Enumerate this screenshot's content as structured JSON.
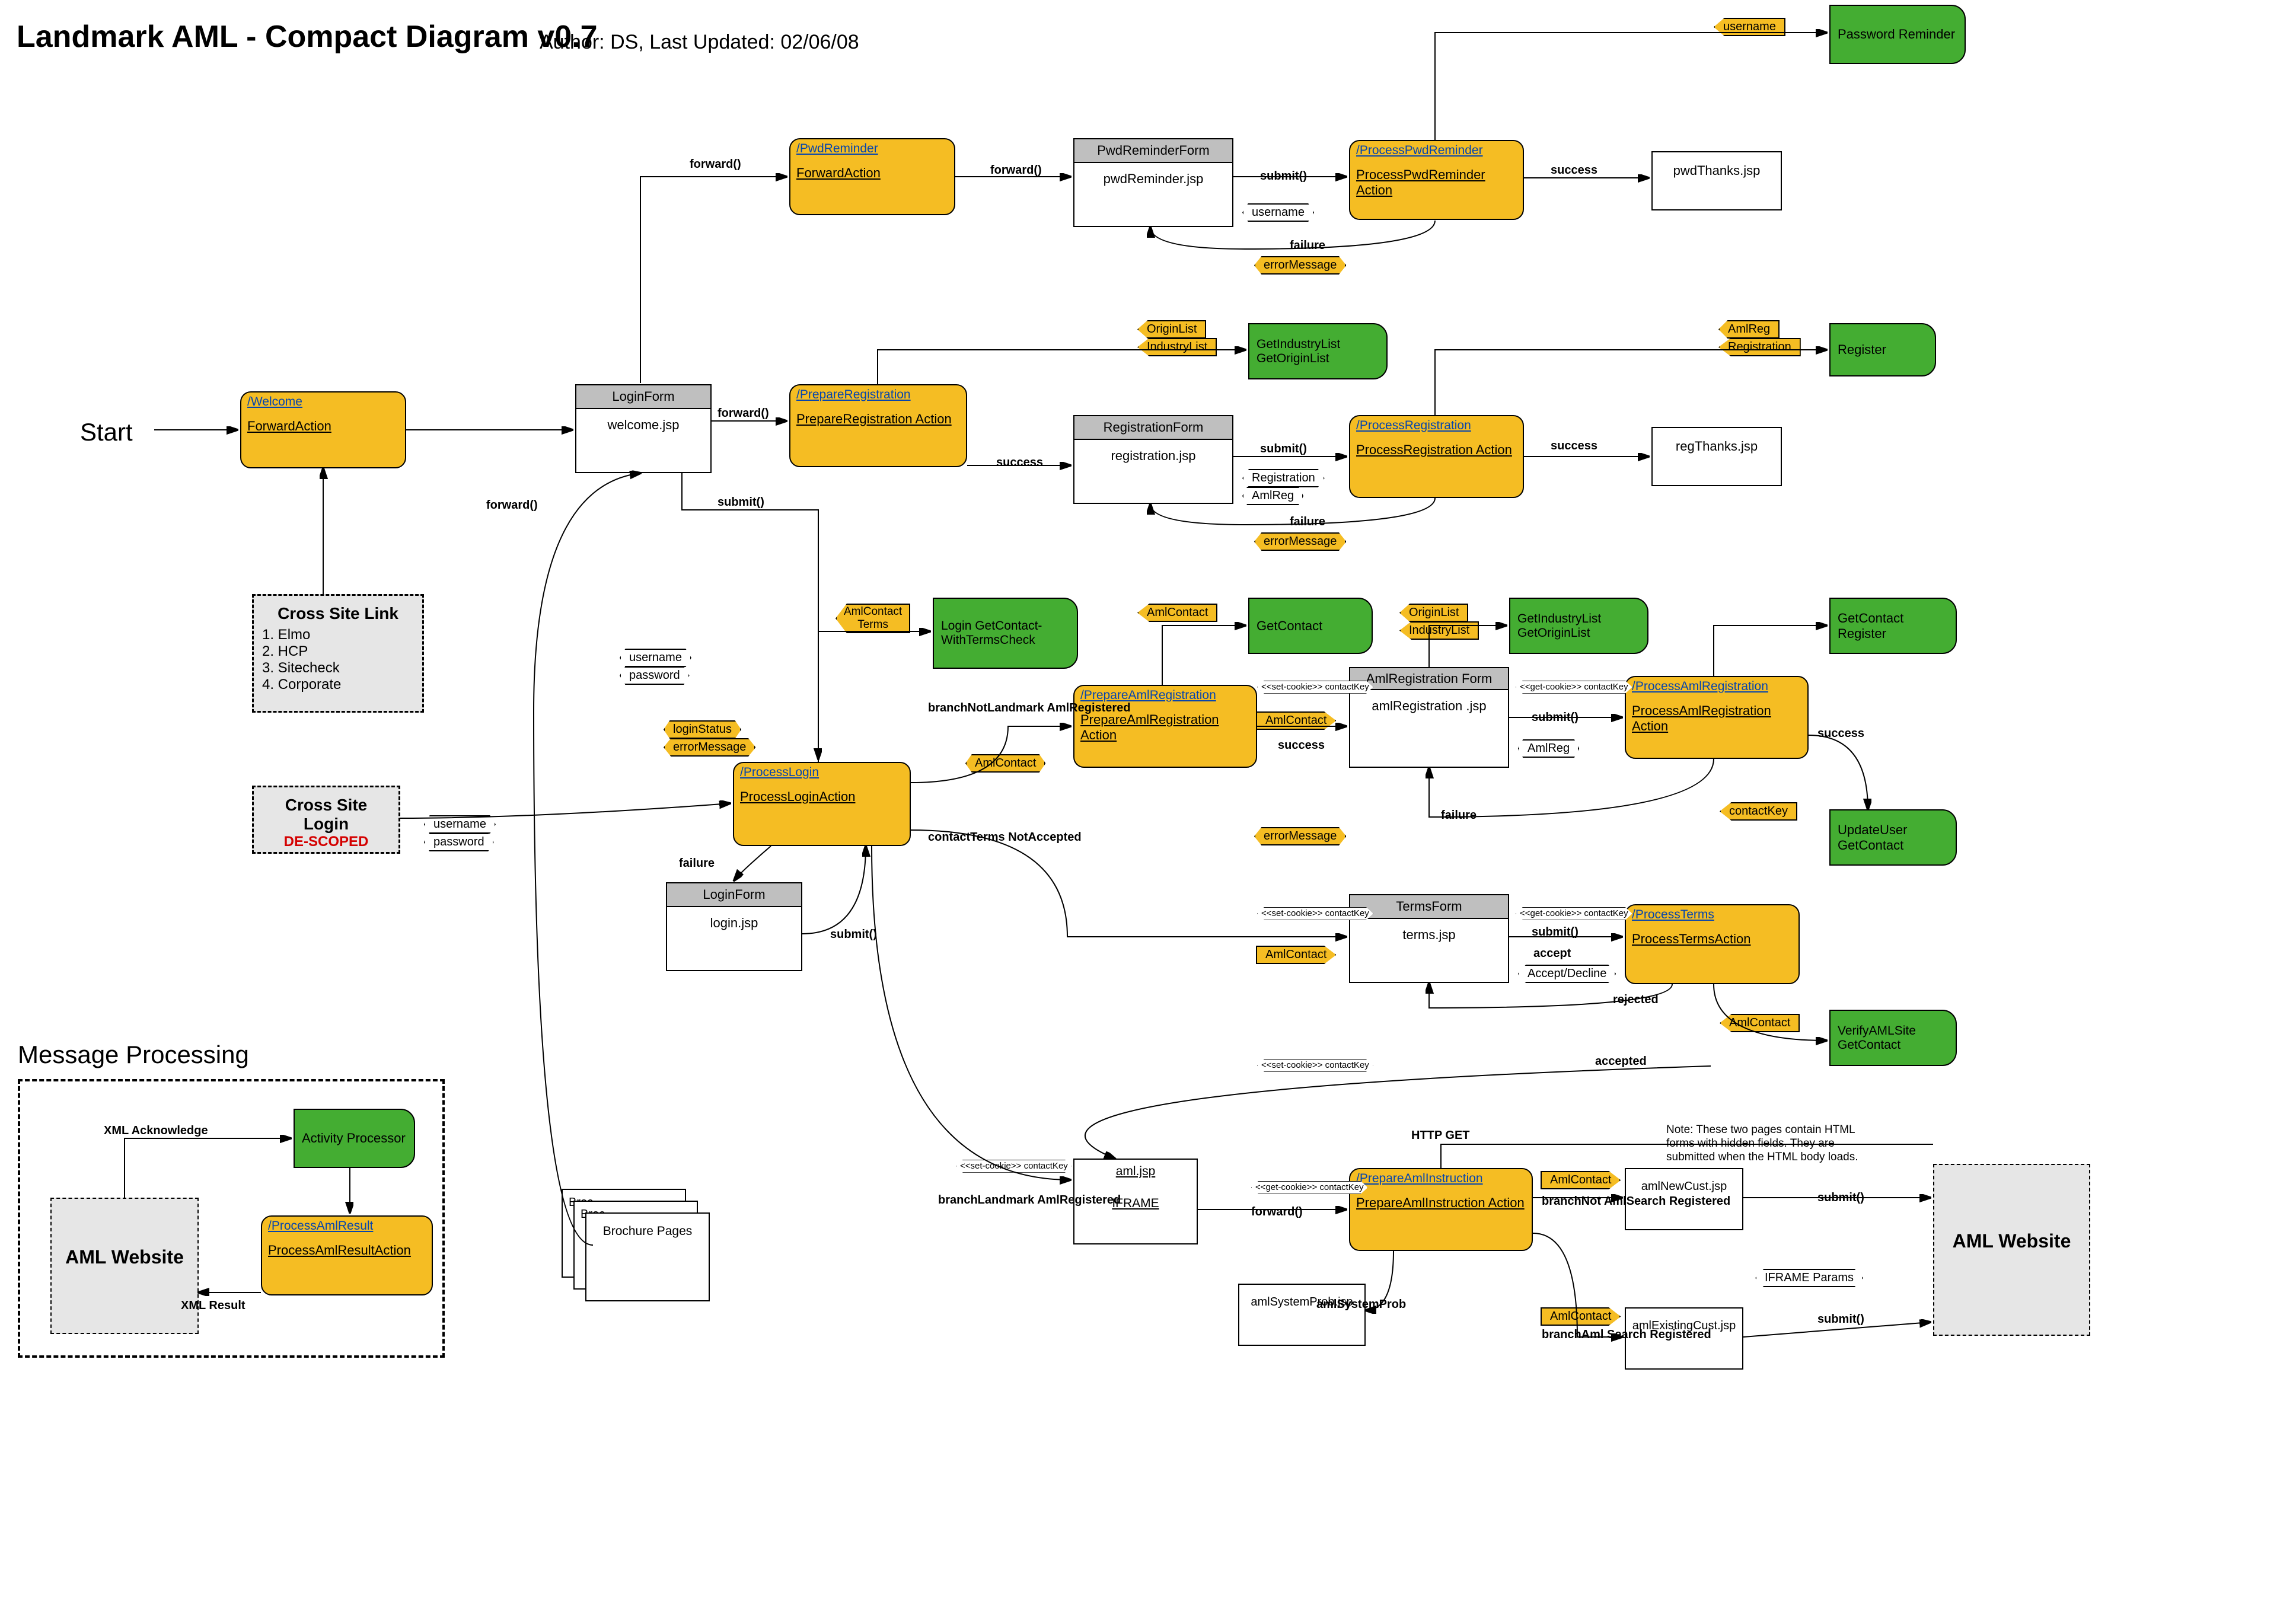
{
  "title": "Landmark AML - Compact Diagram v0.7",
  "author": "Author: DS, Last Updated: 02/06/08",
  "start": "Start",
  "section_msg": "Message Processing",
  "cross_site_link": {
    "title": "Cross Site Link",
    "items": [
      "1. Elmo",
      "2. HCP",
      "3. Sitecheck",
      "4. Corporate"
    ]
  },
  "cross_site_login": {
    "title": "Cross Site Login",
    "de": "DE-SCOPED"
  },
  "actions": {
    "welcome": {
      "path": "/Welcome",
      "name": "ForwardAction"
    },
    "pwdrem": {
      "path": "/PwdReminder",
      "name": "ForwardAction"
    },
    "procpwd": {
      "path": "/ProcessPwdReminder",
      "name": "ProcessPwdReminder Action"
    },
    "prepreg": {
      "path": "/PrepareRegistration",
      "name": "PrepareRegistration Action"
    },
    "procreg": {
      "path": "/ProcessRegistration",
      "name": "ProcessRegistration Action"
    },
    "proclogin": {
      "path": "/ProcessLogin",
      "name": "ProcessLoginAction"
    },
    "prepaml": {
      "path": "/PrepareAmlRegistration",
      "name": "PrepareAmlRegistration Action"
    },
    "procaml": {
      "path": "/ProcessAmlRegistration",
      "name": "ProcessAmlRegistration Action"
    },
    "procterms": {
      "path": "/ProcessTerms",
      "name": "ProcessTermsAction"
    },
    "prepinstr": {
      "path": "/PrepareAmlInstruction",
      "name": "PrepareAmlInstruction Action"
    },
    "procamlres": {
      "path": "/ProcessAmlResult",
      "name": "ProcessAmlResultAction"
    }
  },
  "forms": {
    "loginform": {
      "hdr": "LoginForm",
      "body": "welcome.jsp"
    },
    "pwdremform": {
      "hdr": "PwdReminderForm",
      "body": "pwdReminder.jsp"
    },
    "regform": {
      "hdr": "RegistrationForm",
      "body": "registration.jsp"
    },
    "amlregform": {
      "hdr": "AmlRegistration Form",
      "body": "amlRegistration .jsp"
    },
    "termsform": {
      "hdr": "TermsForm",
      "body": "terms.jsp"
    },
    "loginform2": {
      "hdr": "LoginForm",
      "body": "login.jsp"
    }
  },
  "pages": {
    "pwdthanks": "pwdThanks.jsp",
    "regthanks": "regThanks.jsp",
    "amljsp": "aml.jsp",
    "iframe": "IFRAME",
    "amlsysprob": "amlSystemProb.jsp",
    "amlnewcust": "amlNewCust.jsp",
    "amlexistcust": "amlExistingCust.jsp",
    "brochure": "Brochure Pages",
    "broc_short": "Broc",
    "amlweb1": "AML Website",
    "amlweb2": "AML Website"
  },
  "svcs": {
    "pwdrem": "Password Reminder",
    "getind": "GetIndustryList GetOriginList",
    "reg": "Register",
    "logingc": "Login GetContact-WithTermsCheck",
    "getcon": "GetContact",
    "getind2": "GetIndustryList GetOriginList",
    "getconreg": "GetContact Register",
    "upduser": "UpdateUser GetContact",
    "verify": "VerifyAMLSite GetContact",
    "actproc": "Activity Processor"
  },
  "tags": {
    "username_top": "username",
    "errmsg1": "errorMessage",
    "origin1": "OriginList",
    "industry1": "IndustryList",
    "amlreg": "AmlReg",
    "registration": "Registration",
    "username_w": "username",
    "reg_w": "Registration",
    "amlreg_w": "AmlReg",
    "errmsg2": "errorMessage",
    "loginstatus": "loginStatus",
    "errmsg3": "errorMessage",
    "username_w2": "username",
    "password_w": "password",
    "username_w3": "username",
    "password_w2": "password",
    "amlcontactterms": "AmlContact Terms",
    "amlcontact1": "AmlContact",
    "amlcontact2": "AmlContact",
    "amlcontact3": "AmlContact",
    "origin2": "OriginList",
    "industry2": "IndustryList",
    "amlreg_w2": "AmlReg",
    "contactkey": "contactKey",
    "errmsg4": "errorMessage",
    "amlcontact4": "AmlContact",
    "amlcontact5": "AmlContact",
    "amlcontact6": "AmlContact",
    "amlcontact7": "AmlContact",
    "acceptdecline": "Accept/Decline",
    "iframeparams": "IFRAME Params"
  },
  "edgelbls": {
    "fwd1": "forward()",
    "fwd2": "forward()",
    "fwd3": "forward()",
    "fwd4": "forward()",
    "fwd5": "forward()",
    "submit1": "submit()",
    "submit2": "submit()",
    "submit3": "submit()",
    "submit4": "submit()",
    "submit5": "submit()",
    "submit6": "submit()",
    "submit7": "submit()",
    "succ1": "success",
    "succ2": "success",
    "succ3": "success",
    "succ4": "success",
    "succ5": "success",
    "fail1": "failure",
    "fail2": "failure",
    "fail3": "failure",
    "fail4": "failure",
    "branchNot": "branchNotLandmark AmlRegistered",
    "branchLand": "branchLandmark AmlRegistered",
    "ctna": "contactTerms NotAccepted",
    "accept": "accept",
    "rejected": "rejected",
    "accepted": "accepted",
    "httpget": "HTTP GET",
    "branchNotAml": "branchNot AmlSearch Registered",
    "branchAmlS": "branchAml Search Registered",
    "amlsys": "amlSystemProb",
    "xmlack": "XML Acknowledge",
    "xmlres": "XML Result"
  },
  "cookies": {
    "set": "<<set-cookie>> contactKey",
    "get": "<<get-cookie>> contactKey"
  },
  "note2": "Note: These two pages contain HTML forms with hidden fields. They are submitted when the HTML body loads."
}
